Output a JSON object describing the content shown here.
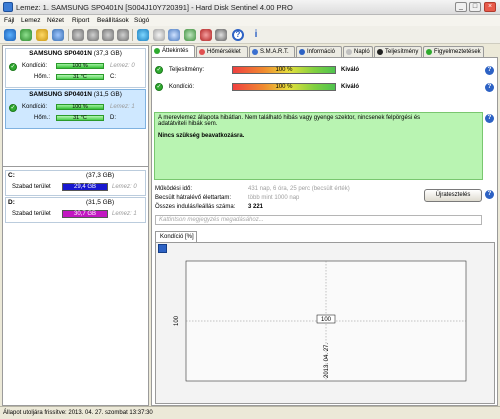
{
  "window": {
    "title": "Lemez: 1. SAMSUNG SP0401N [S004J10Y720391] - Hard Disk Sentinel 4.00 PRO"
  },
  "menu": [
    "Fájl",
    "Lemez",
    "Nézet",
    "Riport",
    "Beállítások",
    "Súgó"
  ],
  "disks": [
    {
      "name": "SAMSUNG SP0401N",
      "size": "(37,3 GB)",
      "health_label": "Kondíció:",
      "health": "100 %",
      "health_fraction": 1.0,
      "disk_id": "Lemez: 0",
      "temp_label": "Hőm.:",
      "temp": "31 °C",
      "drive": "C:"
    },
    {
      "name": "SAMSUNG SP0401N",
      "size": "(31,5 GB)",
      "health_label": "Kondíció:",
      "health": "100 %",
      "health_fraction": 1.0,
      "disk_id": "Lemez: 1",
      "temp_label": "Hőm.:",
      "temp": "31 °C",
      "drive": "D:"
    }
  ],
  "partitions": [
    {
      "letter": "C:",
      "size": "(37,3 GB)",
      "free_label": "Szabad terület",
      "free": "29,4 GB",
      "disk_id": "Lemez: 0",
      "bar_color": "#1818d0"
    },
    {
      "letter": "D:",
      "size": "(31,5 GB)",
      "free_label": "Szabad terület",
      "free": "30,7 GB",
      "disk_id": "Lemez: 1",
      "bar_color": "#c218c2"
    }
  ],
  "tabs": [
    "Áttekintés",
    "Hőmérséklet",
    "S.M.A.R.T.",
    "Információ",
    "Napló",
    "Teljesítmény",
    "Figyelmeztetések"
  ],
  "overview": {
    "performance_label": "Teljesítmény:",
    "performance_value": "100 %",
    "performance_rating": "Kiváló",
    "health_label": "Kondíció:",
    "health_value": "100 %",
    "health_rating": "Kiváló",
    "message_line1": "A merevlemez állapota hibátlan. Nem található hibás vagy gyenge szektor, nincsenek felpörgési és",
    "message_line2": "adatátviteli hibák sem.",
    "message_bold": "Nincs szükség beavatkozásra.",
    "power_on_label": "Működési idő:",
    "power_on_value": "431 nap, 6 óra, 25 perc (becsült érték)",
    "remaining_label": "Becsült hátralévő élettartam:",
    "remaining_value": "több mint 1000 nap",
    "starts_label": "Összes indulás/leállás száma:",
    "starts_value": "3 221",
    "repeat_button": "Újratesztelés",
    "comment_placeholder": "Kattintson megjegyzés megadásához..."
  },
  "chart_tab": "Kondíció [%]",
  "chart_data": {
    "type": "line",
    "x": [
      "2013. 04. 27."
    ],
    "values": [
      100
    ],
    "data_label": "100",
    "ytick": "100",
    "xtick": "2013. 04. 27."
  },
  "statusbar": {
    "text": "Állapot utoljára frissítve: 2013. 04. 27. szombat 13:37:30"
  }
}
